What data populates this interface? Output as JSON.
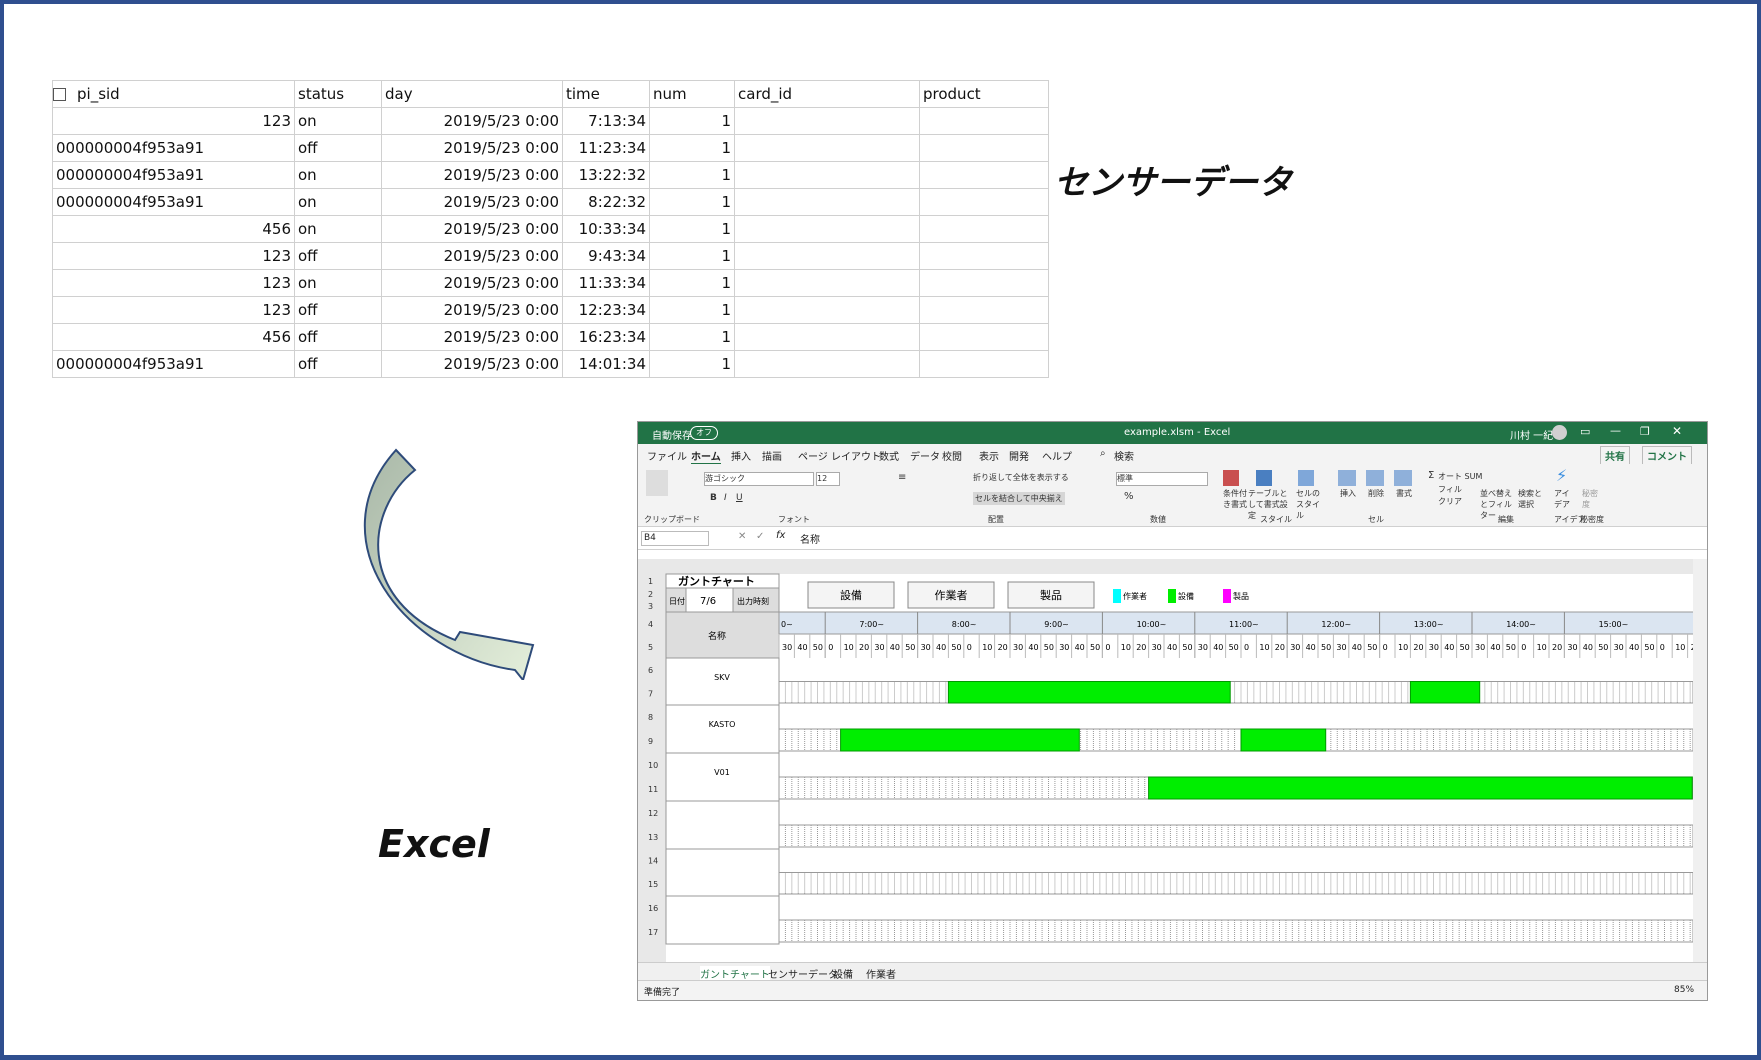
{
  "sensor_table": {
    "columns": [
      "pi_sid",
      "status",
      "day",
      "time",
      "num",
      "card_id",
      "product"
    ],
    "rows": [
      [
        "123",
        "on",
        "2019/5/23 0:00",
        "7:13:34",
        "1",
        "",
        ""
      ],
      [
        "000000004f953a91",
        "off",
        "2019/5/23 0:00",
        "11:23:34",
        "1",
        "",
        ""
      ],
      [
        "000000004f953a91",
        "on",
        "2019/5/23 0:00",
        "13:22:32",
        "1",
        "",
        ""
      ],
      [
        "000000004f953a91",
        "on",
        "2019/5/23 0:00",
        "8:22:32",
        "1",
        "",
        ""
      ],
      [
        "456",
        "on",
        "2019/5/23 0:00",
        "10:33:34",
        "1",
        "",
        ""
      ],
      [
        "123",
        "off",
        "2019/5/23 0:00",
        "9:43:34",
        "1",
        "",
        ""
      ],
      [
        "123",
        "on",
        "2019/5/23 0:00",
        "11:33:34",
        "1",
        "",
        ""
      ],
      [
        "123",
        "off",
        "2019/5/23 0:00",
        "12:23:34",
        "1",
        "",
        ""
      ],
      [
        "456",
        "off",
        "2019/5/23 0:00",
        "16:23:34",
        "1",
        "",
        ""
      ],
      [
        "000000004f953a91",
        "off",
        "2019/5/23 0:00",
        "14:01:34",
        "1",
        "",
        ""
      ]
    ]
  },
  "labels": {
    "sensor_data": "センサーデータ",
    "excel": "Excel"
  },
  "excel": {
    "autosave": "自動保存",
    "autosave_state": "オフ",
    "file_title": "example.xlsm  -  Excel",
    "user": "川村 一紀",
    "menu": [
      "ファイル",
      "ホーム",
      "挿入",
      "描画",
      "ページ レイアウト",
      "数式",
      "データ",
      "校閲",
      "表示",
      "開発",
      "ヘルプ"
    ],
    "search": "検索",
    "share": "共有",
    "comment": "コメント",
    "font_name": "游ゴシック",
    "font_size": "12",
    "wrap_text": "折り返して全体を表示する",
    "merge_center": "セルを結合して中央揃え",
    "number_format": "標準",
    "autosum": "オート SUM",
    "fill": "フィル",
    "clear": "クリア",
    "ribbon_groups": [
      "クリップボード",
      "フォント",
      "配置",
      "数値",
      "スタイル",
      "セル",
      "編集",
      "アイデア",
      "秘密度"
    ],
    "ribbon_buttons": [
      "条件付き書式",
      "テーブルとして書式設定",
      "セルのスタイル",
      "挿入",
      "削除",
      "書式",
      "並べ替えとフィルター",
      "検索と選択",
      "アイデア",
      "秘密度"
    ],
    "cell_ref": "B4",
    "formula": "名称",
    "gantt_title": "ガントチャート",
    "date_label": "日付",
    "date_value": "7/6",
    "output_time": "出力時刻",
    "name_header": "名称",
    "buttons": [
      "設備",
      "作業者",
      "製品"
    ],
    "legend": [
      {
        "label": "作業者",
        "color": "#00ffff"
      },
      {
        "label": "設備",
        "color": "#00ee00"
      },
      {
        "label": "製品",
        "color": "#ff00ff"
      }
    ],
    "hours": [
      "0~",
      "7:00~",
      "8:00~",
      "9:00~",
      "10:00~",
      "11:00~",
      "12:00~",
      "13:00~",
      "14:00~",
      "15:00~"
    ],
    "minutes": [
      "30",
      "40",
      "50",
      "0",
      "10",
      "20",
      "30",
      "40",
      "50"
    ],
    "resources": [
      "SKV",
      "KASTO",
      "V01",
      "",
      "",
      ""
    ],
    "bars": [
      {
        "row": 0,
        "start": "8:20",
        "end": "11:23"
      },
      {
        "row": 0,
        "start": "13:20",
        "end": "14:05"
      },
      {
        "row": 1,
        "start": "7:10",
        "end": "9:45"
      },
      {
        "row": 1,
        "start": "11:30",
        "end": "12:25"
      },
      {
        "row": 2,
        "start": "10:30",
        "end": "16:23"
      }
    ],
    "row_numbers": [
      "1",
      "2",
      "3",
      "4",
      "5",
      "6",
      "7",
      "8",
      "9",
      "10",
      "11",
      "12",
      "13",
      "14",
      "15",
      "16",
      "17"
    ],
    "sheet_tabs": [
      "ガントチャート",
      "センサーデータ",
      "設備",
      "作業者"
    ],
    "status": "準備完了",
    "zoom": "85%"
  }
}
